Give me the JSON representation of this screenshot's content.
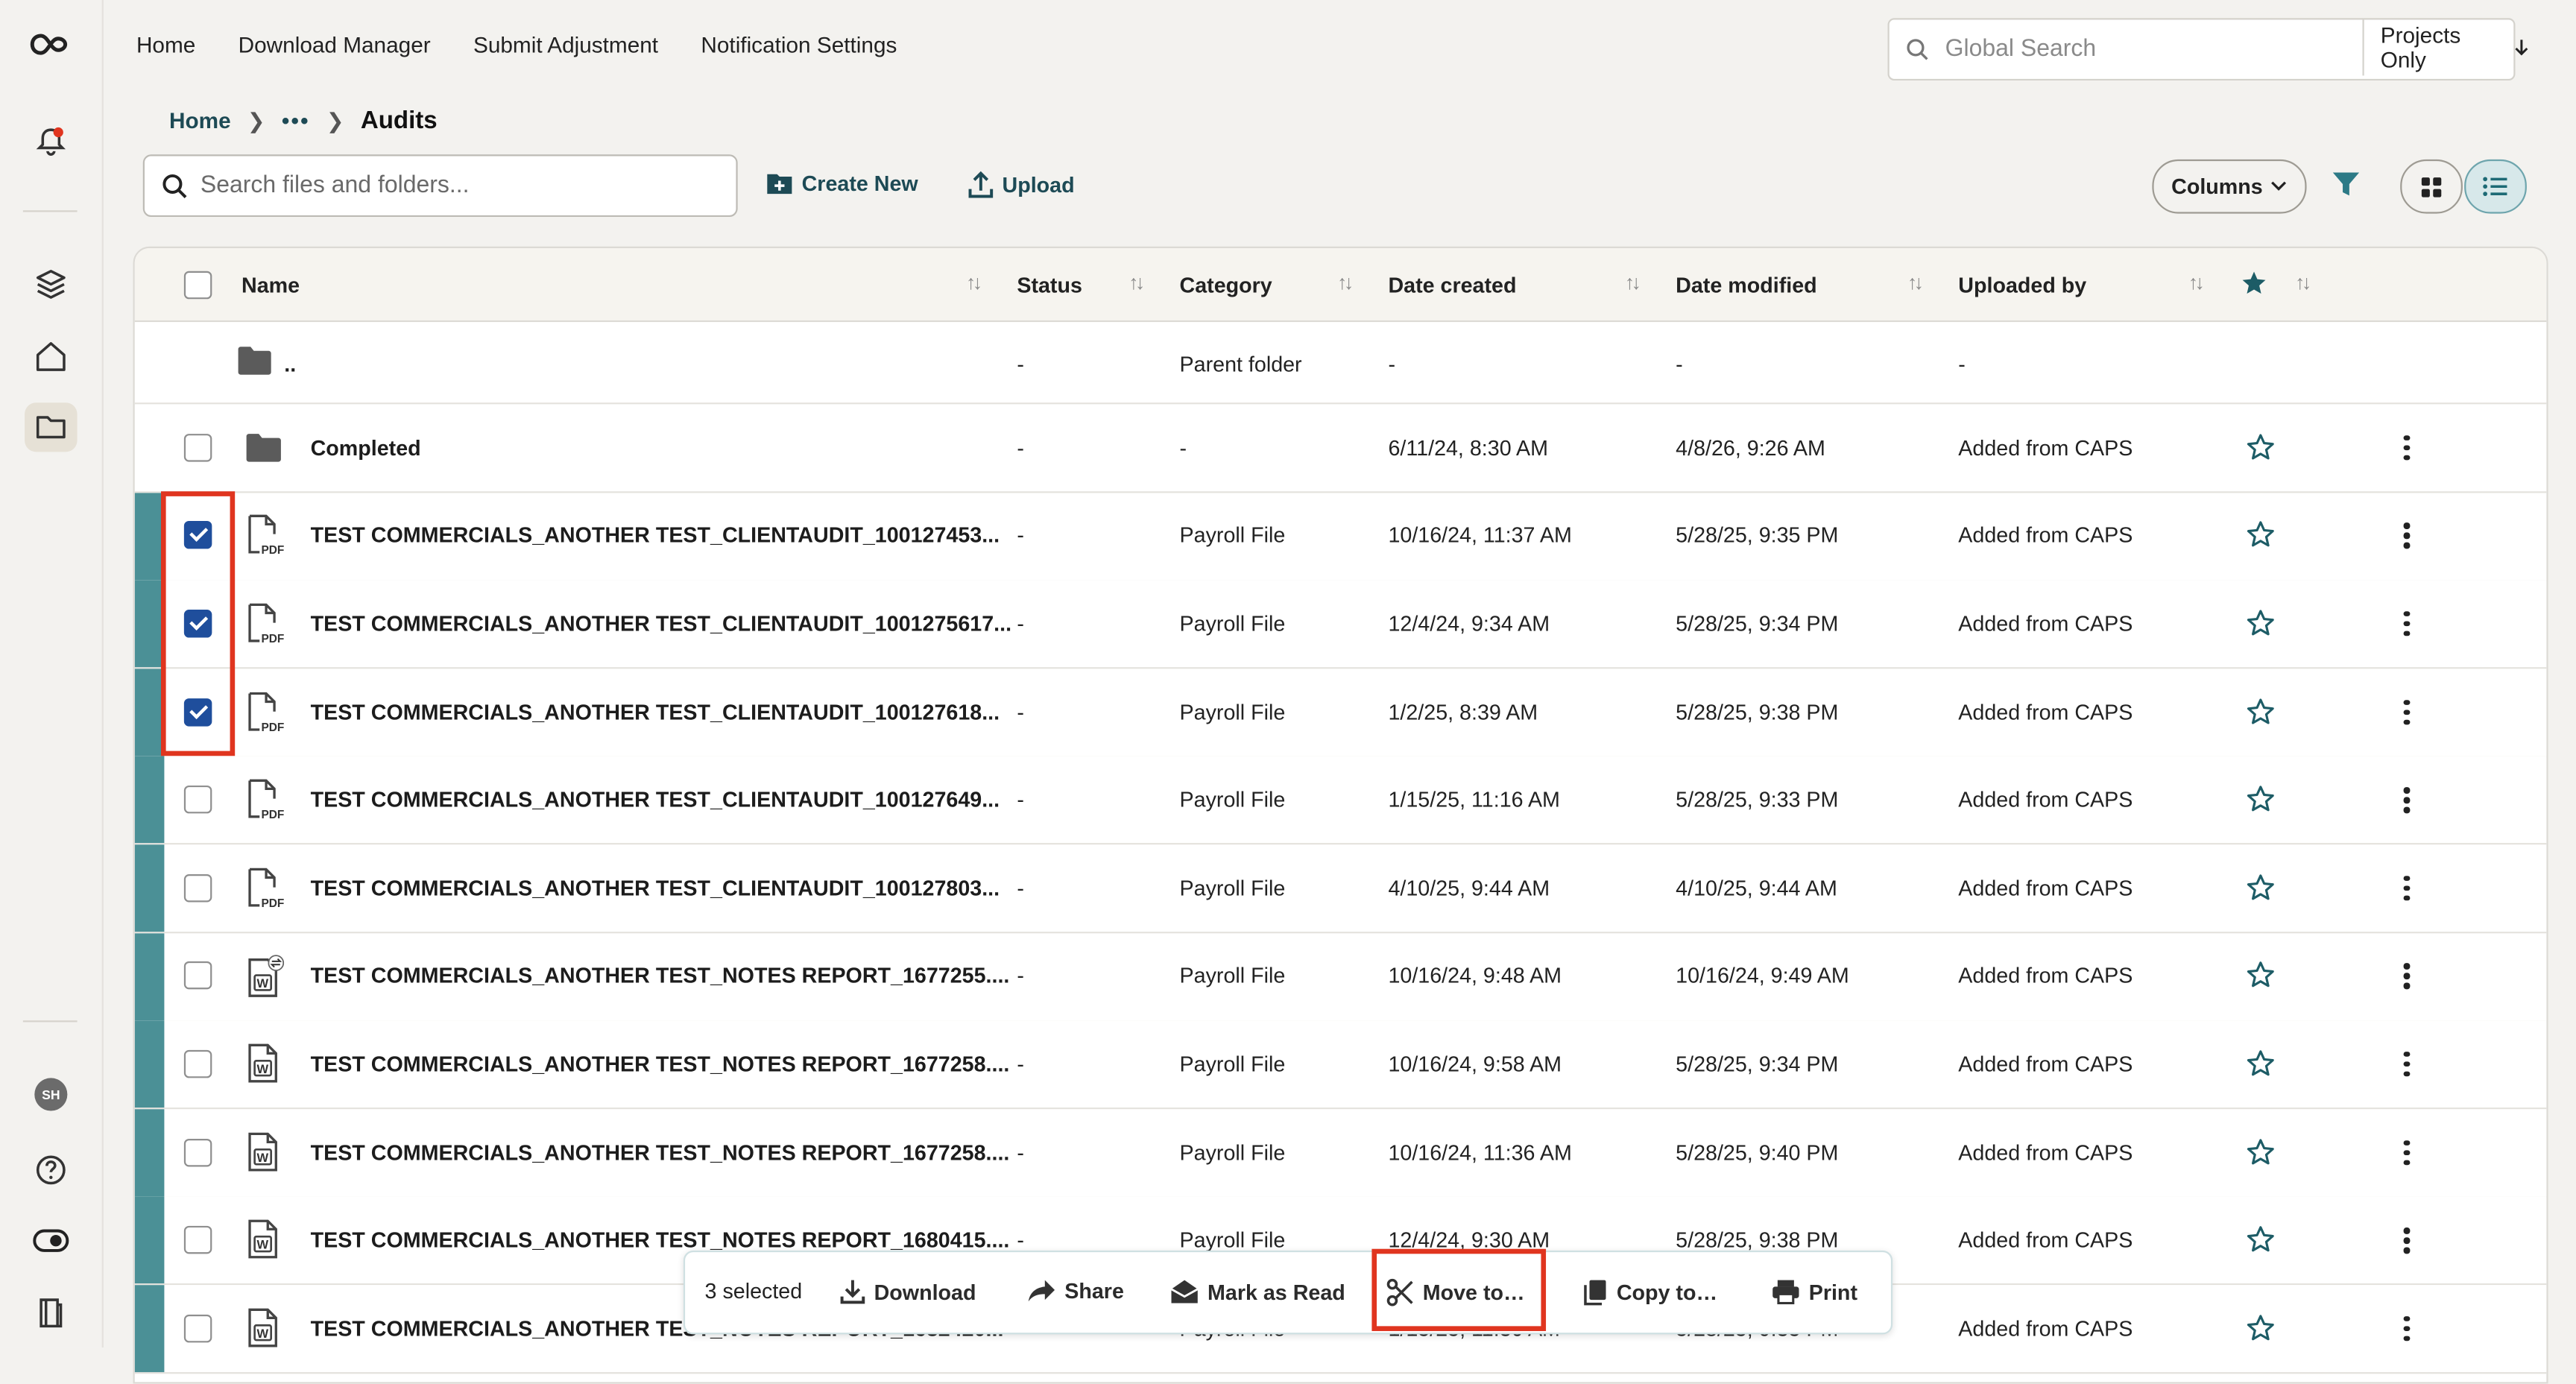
{
  "nav": {
    "items": [
      "Home",
      "Download Manager",
      "Submit Adjustment",
      "Notification Settings"
    ],
    "search_placeholder": "Global Search",
    "scope_label": "Projects Only"
  },
  "rail": {
    "avatar_initials": "SH",
    "icons": [
      "logo-icon",
      "bell-icon",
      "layers-icon",
      "home-icon",
      "folder-icon",
      "help-icon",
      "toggle-icon",
      "book-icon"
    ]
  },
  "breadcrumb": {
    "home": "Home",
    "ellipsis": "•••",
    "current": "Audits"
  },
  "toolbar": {
    "search_placeholder": "Search files and folders...",
    "create_label": "Create New",
    "upload_label": "Upload",
    "columns_label": "Columns"
  },
  "table": {
    "headers": {
      "name": "Name",
      "status": "Status",
      "category": "Category",
      "date_created": "Date created",
      "date_modified": "Date modified",
      "uploaded_by": "Uploaded by"
    },
    "parent": {
      "name": "..",
      "status": "-",
      "category": "Parent folder",
      "created": "-",
      "modified": "-",
      "uploaded": "-"
    },
    "rows": [
      {
        "type": "folder",
        "checked": false,
        "name": "Completed",
        "status": "-",
        "category": "-",
        "created": "6/11/24, 8:30 AM",
        "modified": "4/8/26, 9:26 AM",
        "uploaded": "Added from CAPS"
      },
      {
        "type": "pdf",
        "checked": true,
        "name": "TEST COMMERCIALS_ANOTHER TEST_CLIENTAUDIT_100127453...",
        "status": "-",
        "category": "Payroll File",
        "created": "10/16/24, 11:37 AM",
        "modified": "5/28/25, 9:35 PM",
        "uploaded": "Added from CAPS"
      },
      {
        "type": "pdf",
        "checked": true,
        "name": "TEST COMMERCIALS_ANOTHER TEST_CLIENTAUDIT_1001275617...",
        "status": "-",
        "category": "Payroll File",
        "created": "12/4/24, 9:34 AM",
        "modified": "5/28/25, 9:34 PM",
        "uploaded": "Added from CAPS"
      },
      {
        "type": "pdf",
        "checked": true,
        "name": "TEST COMMERCIALS_ANOTHER TEST_CLIENTAUDIT_100127618...",
        "status": "-",
        "category": "Payroll File",
        "created": "1/2/25, 8:39 AM",
        "modified": "5/28/25, 9:38 PM",
        "uploaded": "Added from CAPS"
      },
      {
        "type": "pdf",
        "checked": false,
        "name": "TEST COMMERCIALS_ANOTHER TEST_CLIENTAUDIT_100127649...",
        "status": "-",
        "category": "Payroll File",
        "created": "1/15/25, 11:16 AM",
        "modified": "5/28/25, 9:33 PM",
        "uploaded": "Added from CAPS"
      },
      {
        "type": "pdf",
        "checked": false,
        "name": "TEST COMMERCIALS_ANOTHER TEST_CLIENTAUDIT_100127803...",
        "status": "-",
        "category": "Payroll File",
        "created": "4/10/25, 9:44 AM",
        "modified": "4/10/25, 9:44 AM",
        "uploaded": "Added from CAPS"
      },
      {
        "type": "word-sync",
        "checked": false,
        "name": "TEST COMMERCIALS_ANOTHER TEST_NOTES REPORT_1677255....",
        "status": "-",
        "category": "Payroll File",
        "created": "10/16/24, 9:48 AM",
        "modified": "10/16/24, 9:49 AM",
        "uploaded": "Added from CAPS"
      },
      {
        "type": "word",
        "checked": false,
        "name": "TEST COMMERCIALS_ANOTHER TEST_NOTES REPORT_1677258....",
        "status": "-",
        "category": "Payroll File",
        "created": "10/16/24, 9:58 AM",
        "modified": "5/28/25, 9:34 PM",
        "uploaded": "Added from CAPS"
      },
      {
        "type": "word",
        "checked": false,
        "name": "TEST COMMERCIALS_ANOTHER TEST_NOTES REPORT_1677258....",
        "status": "-",
        "category": "Payroll File",
        "created": "10/16/24, 11:36 AM",
        "modified": "5/28/25, 9:40 PM",
        "uploaded": "Added from CAPS"
      },
      {
        "type": "word",
        "checked": false,
        "name": "TEST COMMERCIALS_ANOTHER TEST_NOTES REPORT_1680415....",
        "status": "-",
        "category": "Payroll File",
        "created": "12/4/24, 9:30 AM",
        "modified": "5/28/25, 9:38 PM",
        "uploaded": "Added from CAPS"
      },
      {
        "type": "word",
        "checked": false,
        "name": "TEST COMMERCIALS_ANOTHER TEST_NOTES REPORT_1682420...",
        "status": "-",
        "category": "Payroll File",
        "created": "1/15/25, 11:30 AM",
        "modified": "5/28/25, 9:35 PM",
        "uploaded": "Added from CAPS"
      }
    ]
  },
  "bulk": {
    "selected": "3 selected",
    "download": "Download",
    "share": "Share",
    "mark_read": "Mark as Read",
    "move": "Move to…",
    "copy": "Copy to…",
    "print": "Print"
  },
  "colors": {
    "accent": "#1d4a55",
    "row_bar": "#4b9096",
    "checkbox": "#1f4e9c",
    "highlight": "#e0351f"
  }
}
